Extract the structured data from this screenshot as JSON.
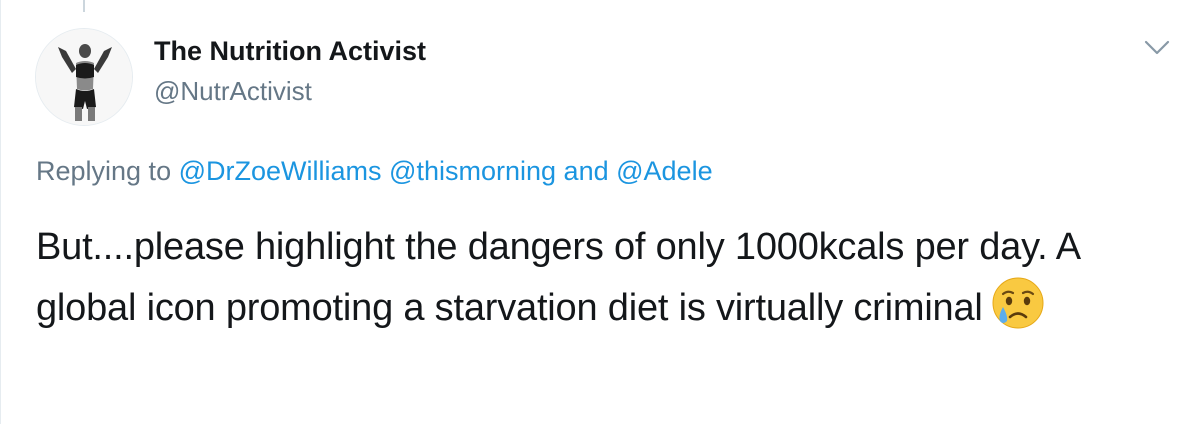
{
  "author": {
    "display_name": "The Nutrition Activist",
    "handle": "@NutrActivist"
  },
  "reply_context": {
    "prefix": "Replying to",
    "mentions": [
      "@DrZoeWilliams",
      "@thismorning",
      "@Adele"
    ],
    "conjunction": "and"
  },
  "tweet": {
    "text": "But....please highlight the dangers of only 1000kcals per day. A global icon promoting a starvation diet is virtually criminal",
    "emoji": "crying-face"
  },
  "icons": {
    "menu": "chevron-down-icon",
    "avatar": "avatar"
  },
  "colors": {
    "link": "#1b95e0",
    "secondary_text": "#657786",
    "primary_text": "#14171a"
  }
}
